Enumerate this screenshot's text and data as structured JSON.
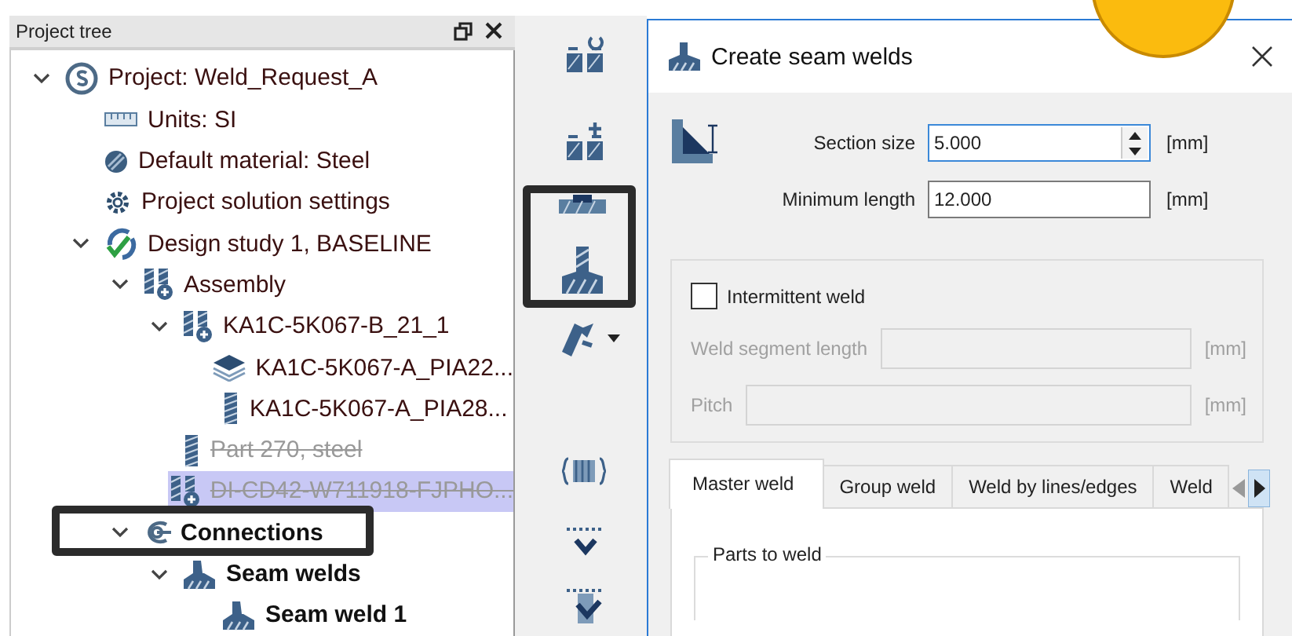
{
  "project_tree": {
    "title": "Project tree",
    "items": [
      {
        "label": "Project: Weld_Request_A",
        "kind": "project",
        "expanded": true,
        "selected": false,
        "suppressed": false,
        "emphasized": false,
        "children": [
          {
            "label": "Units: SI",
            "kind": "units",
            "selected": false,
            "suppressed": false,
            "emphasized": false
          },
          {
            "label": "Default material: Steel",
            "kind": "material",
            "selected": false,
            "suppressed": false,
            "emphasized": false
          },
          {
            "label": "Project solution settings",
            "kind": "settings",
            "selected": false,
            "suppressed": false,
            "emphasized": false
          },
          {
            "label": "Design study 1, BASELINE",
            "kind": "study",
            "expanded": true,
            "selected": false,
            "suppressed": false,
            "emphasized": false,
            "children": [
              {
                "label": "Assembly",
                "kind": "assembly",
                "expanded": true,
                "selected": false,
                "suppressed": false,
                "emphasized": false,
                "children": [
                  {
                    "label": "KA1C-5K067-B_21_1",
                    "kind": "assembly",
                    "expanded": true,
                    "selected": false,
                    "suppressed": false,
                    "emphasized": false,
                    "children": [
                      {
                        "label": "KA1C-5K067-A_PIA22...",
                        "kind": "layers",
                        "selected": false,
                        "suppressed": false,
                        "emphasized": false
                      },
                      {
                        "label": "KA1C-5K067-A_PIA28...",
                        "kind": "part",
                        "selected": false,
                        "suppressed": false,
                        "emphasized": false
                      }
                    ]
                  },
                  {
                    "label": "Part 270, steel",
                    "kind": "part",
                    "selected": false,
                    "suppressed": true,
                    "emphasized": false
                  },
                  {
                    "label": "DI-CD42-W711918-FJPHO...",
                    "kind": "assembly",
                    "selected": true,
                    "suppressed": true,
                    "emphasized": false
                  }
                ]
              },
              {
                "label": "Connections",
                "kind": "connections",
                "expanded": true,
                "selected": false,
                "suppressed": false,
                "emphasized": true,
                "children": [
                  {
                    "label": "Seam welds",
                    "kind": "weld",
                    "expanded": true,
                    "selected": false,
                    "suppressed": false,
                    "emphasized": true,
                    "children": [
                      {
                        "label": "Seam weld 1",
                        "kind": "weld",
                        "selected": false,
                        "suppressed": false,
                        "emphasized": true
                      }
                    ]
                  }
                ]
              }
            ]
          }
        ]
      }
    ]
  },
  "dialog": {
    "title": "Create seam welds",
    "fields": [
      {
        "label": "Section size",
        "value": "5.000",
        "unit": "[mm]",
        "kind": "spin",
        "focused": true
      },
      {
        "label": "Minimum length",
        "value": "12.000",
        "unit": "[mm]",
        "kind": "text",
        "focused": false
      }
    ],
    "intermittent": {
      "label": "Intermittent weld",
      "checked": false,
      "fields": [
        {
          "label": "Weld segment length",
          "unit": "[mm]",
          "disabled": true
        },
        {
          "label": "Pitch",
          "unit": "[mm]",
          "disabled": true
        }
      ]
    },
    "tabs": [
      {
        "label": "Master weld",
        "selected": true
      },
      {
        "label": "Group weld",
        "selected": false
      },
      {
        "label": "Weld by lines/edges",
        "selected": false
      },
      {
        "label": "Weld",
        "selected": false
      }
    ],
    "parts_group": {
      "title": "Parts to weld"
    }
  }
}
